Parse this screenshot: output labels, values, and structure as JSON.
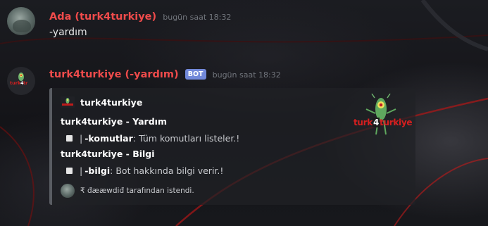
{
  "messages": [
    {
      "author": "Ada (turk4turkiye)",
      "timestamp": "bugün saat 18:32",
      "content": "-yardım"
    },
    {
      "author": "turk4turkiye (-yardım)",
      "bot_tag": "BOT",
      "timestamp": "bugün saat 18:32",
      "embed": {
        "author_name": "turk4turkiye",
        "thumbnail_text_left": "turk",
        "thumbnail_text_num": "4",
        "thumbnail_text_right": "turkiye",
        "fields": [
          {
            "name": "turk4turkiye - Yardım",
            "pipe": "|",
            "command": "-komutlar",
            "description": ": Tüm komutları listeler.!"
          },
          {
            "name": "turk4turkiye - Bilgi",
            "pipe": "|",
            "command": "-bilgi",
            "description": ": Bot hakkında bilgi verir.!"
          }
        ],
        "footer": "₹ đææwdiđ tarafından istendi."
      }
    }
  ],
  "colors": {
    "username": "#ef4b4b",
    "bot_tag": "#7289da",
    "timestamp": "#72767d"
  }
}
